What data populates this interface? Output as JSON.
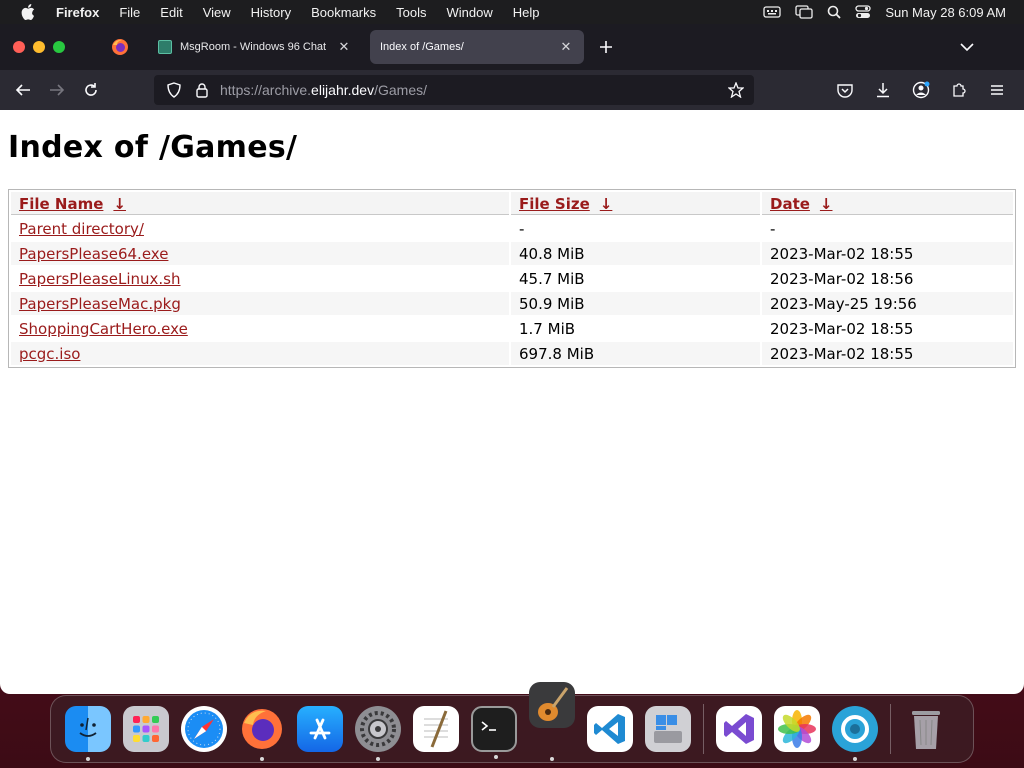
{
  "menubar": {
    "app": "Firefox",
    "items": [
      "File",
      "Edit",
      "View",
      "History",
      "Bookmarks",
      "Tools",
      "Window",
      "Help"
    ],
    "clock": "Sun May 28  6:09 AM"
  },
  "browser": {
    "tabs": [
      {
        "title": "MsgRoom - Windows 96 Chat",
        "active": false
      },
      {
        "title": "Index of /Games/",
        "active": true
      }
    ],
    "url_prefix": "https://archive.",
    "url_domain": "elijahr.dev",
    "url_path": "/Games/"
  },
  "page": {
    "title": "Index of /Games/",
    "columns": [
      "File Name",
      "File Size",
      "Date"
    ],
    "sort_arrow": "↓",
    "rows": [
      {
        "name": "Parent directory/",
        "size": "-",
        "date": "-"
      },
      {
        "name": "PapersPlease64.exe",
        "size": "40.8 MiB",
        "date": "2023-Mar-02 18:55"
      },
      {
        "name": "PapersPleaseLinux.sh",
        "size": "45.7 MiB",
        "date": "2023-Mar-02 18:56"
      },
      {
        "name": "PapersPleaseMac.pkg",
        "size": "50.9 MiB",
        "date": "2023-May-25 19:56"
      },
      {
        "name": "ShoppingCartHero.exe",
        "size": "1.7 MiB",
        "date": "2023-Mar-02 18:55"
      },
      {
        "name": "pcgc.iso",
        "size": "697.8 MiB",
        "date": "2023-Mar-02 18:55"
      }
    ]
  },
  "colors": {
    "link": "#9a1b1b",
    "tabbar": "#1c1b22",
    "navbar": "#2b2a33"
  },
  "dock": {
    "items": [
      "finder-icon",
      "launchpad-icon",
      "safari-icon",
      "firefox-icon",
      "app-store-icon",
      "system-settings-icon",
      "textedit-icon",
      "terminal-icon",
      "garageband-icon",
      "vscode-icon",
      "boot-camp-icon",
      "visual-studio-icon",
      "photos-icon",
      "app-icon",
      "trash-icon"
    ]
  }
}
